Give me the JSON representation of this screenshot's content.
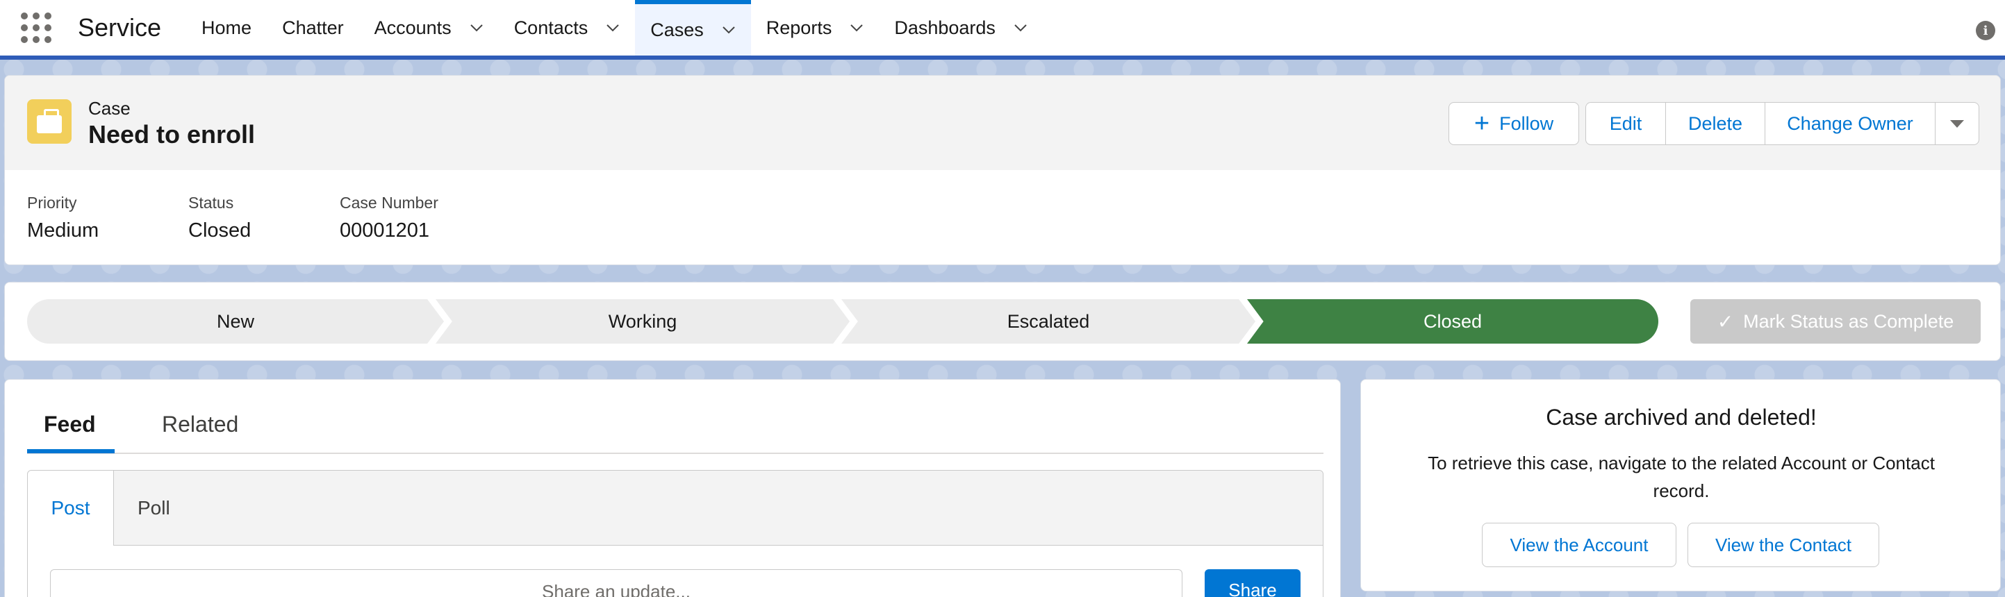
{
  "app": {
    "name": "Service"
  },
  "nav": {
    "items": [
      {
        "label": "Home",
        "dropdown": false
      },
      {
        "label": "Chatter",
        "dropdown": false
      },
      {
        "label": "Accounts",
        "dropdown": true
      },
      {
        "label": "Contacts",
        "dropdown": true
      },
      {
        "label": "Cases",
        "dropdown": true,
        "active": true
      },
      {
        "label": "Reports",
        "dropdown": true
      },
      {
        "label": "Dashboards",
        "dropdown": true
      }
    ]
  },
  "record": {
    "object_label": "Case",
    "title": "Need to enroll",
    "actions": {
      "follow": "Follow",
      "edit": "Edit",
      "delete": "Delete",
      "change_owner": "Change Owner"
    },
    "fields": [
      {
        "label": "Priority",
        "value": "Medium"
      },
      {
        "label": "Status",
        "value": "Closed"
      },
      {
        "label": "Case Number",
        "value": "00001201"
      }
    ]
  },
  "path": {
    "stages": [
      "New",
      "Working",
      "Escalated",
      "Closed"
    ],
    "current": "Closed",
    "mark_complete": "Mark Status as Complete"
  },
  "feed": {
    "tabs": [
      "Feed",
      "Related"
    ],
    "active_tab": "Feed",
    "publisher_tabs": [
      "Post",
      "Poll"
    ],
    "share_placeholder": "Share an update...",
    "share_button": "Share"
  },
  "archive": {
    "title": "Case archived and deleted!",
    "message": "To retrieve this case, navigate to the related Account or Contact record.",
    "view_account": "View the Account",
    "view_contact": "View the Contact"
  },
  "colors": {
    "brand": "#0176d3",
    "path_complete": "#3e8244",
    "case_icon": "#f2cf5b"
  }
}
